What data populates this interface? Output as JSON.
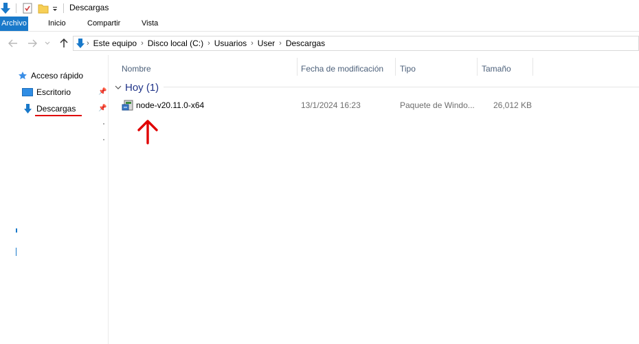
{
  "window": {
    "title": "Descargas"
  },
  "ribbon": {
    "tabs": [
      "Archivo",
      "Inicio",
      "Compartir",
      "Vista"
    ]
  },
  "address": {
    "crumbs": [
      "Este equipo",
      "Disco local (C:)",
      "Usuarios",
      "User",
      "Descargas"
    ]
  },
  "nav": {
    "quick_access": "Acceso rápido",
    "items": [
      {
        "label": "Escritorio",
        "icon": "desktop-icon",
        "pinned": true
      },
      {
        "label": "Descargas",
        "icon": "download-icon",
        "pinned": true
      }
    ]
  },
  "columns": [
    "Nombre",
    "Fecha de modificación",
    "Tipo",
    "Tamaño"
  ],
  "group": {
    "label": "Hoy (1)"
  },
  "files": [
    {
      "name": "node-v20.11.0-x64",
      "modified": "13/1/2024 16:23",
      "type": "Paquete de Windo...",
      "size": "26,012 KB"
    }
  ],
  "colors": {
    "accent": "#1979ca",
    "annotation": "#e00000",
    "group_text": "#1e3287",
    "header_text": "#4c607a"
  }
}
